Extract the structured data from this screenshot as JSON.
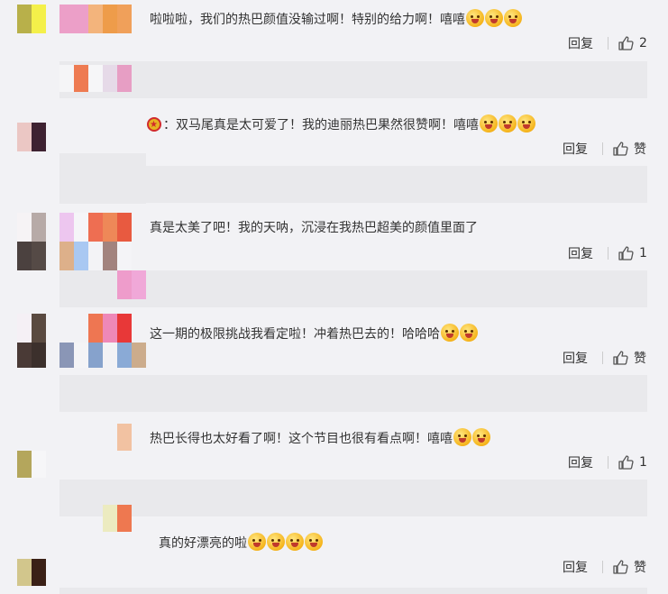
{
  "comments": [
    {
      "text": "啦啦啦，我们的热巴颜值没输过啊！特别的给力啊！嘻嘻",
      "emoji_count": 3,
      "reply_label": "回复",
      "like_label": "2"
    },
    {
      "badge": true,
      "text": "：双马尾真是太可爱了！我的迪丽热巴果然很赞啊！嘻嘻",
      "emoji_count": 3,
      "reply_label": "回复",
      "like_label": "赞"
    },
    {
      "text": "真是太美了吧！我的天呐，沉浸在我热巴超美的颜值里面了",
      "emoji_count": 0,
      "reply_label": "回复",
      "like_label": "1"
    },
    {
      "text": "这一期的极限挑战我看定啦！冲着热巴去的！哈哈哈",
      "emoji_count": 2,
      "reply_label": "回复",
      "like_label": "赞"
    },
    {
      "text": "热巴长得也太好看了啊！这个节目也很有看点啊！嘻嘻",
      "emoji_count": 2,
      "reply_label": "回复",
      "like_label": "1"
    },
    {
      "text": "真的好漂亮的啦",
      "emoji_count": 4,
      "reply_label": "回复",
      "like_label": "赞"
    }
  ],
  "icons": {
    "like": "thumbs-up-icon",
    "emoji": "smiley-emoji-icon",
    "badge": "medal-badge-icon"
  },
  "colors": {
    "background": "#f2f2f5",
    "divider": "#e9e9ec",
    "text": "#333333"
  }
}
